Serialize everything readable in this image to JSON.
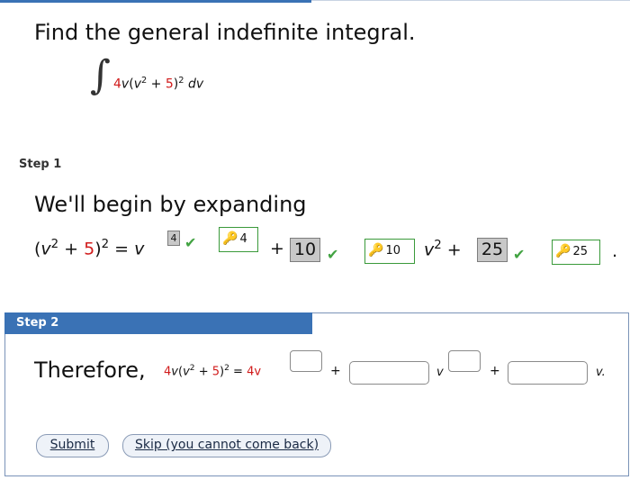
{
  "problem": {
    "prompt": "Find the general indefinite integral.",
    "integral_sign": "∫",
    "integrand": {
      "coef": "4",
      "var": "v",
      "open": "(",
      "inner_var": "v",
      "inner_exp": "2",
      "plus": " + ",
      "const": "5",
      "close": ")",
      "outer_exp": "2",
      "dv": "dv"
    }
  },
  "step1": {
    "label": "Step 1",
    "heading": "We'll begin by expanding",
    "equation": {
      "open": "(",
      "v": "v",
      "exp2": "2",
      "plus": " + ",
      "five": "5",
      "close": ")",
      "outer_exp": "2",
      "equals": " = ",
      "v_out": "v",
      "blank1": "4",
      "answer1": "4",
      "plus2": "+",
      "blank2": "10",
      "answer2": "10",
      "v_term": "v",
      "v_exp": "2",
      "plus3": " + ",
      "blank3": "25",
      "answer3": "25",
      "period": "."
    }
  },
  "step2": {
    "label": "Step 2",
    "therefore": "Therefore,",
    "expr": {
      "coef": "4",
      "var": "v",
      "open": "(",
      "inner_var": "v",
      "inner_exp": "2",
      "plus": " + ",
      "const": "5",
      "close": ")",
      "outer_exp": "2",
      "equals": " = ",
      "rhs_coef": "4v",
      "plus1": "+",
      "v_mid": "v",
      "plus2": "+",
      "v_end": "v."
    }
  },
  "buttons": {
    "submit": "Submit",
    "skip": "Skip (you cannot come back)"
  },
  "colors": {
    "accent": "#3a72b5",
    "highlight": "#d11b1b",
    "correct": "#42a342"
  }
}
